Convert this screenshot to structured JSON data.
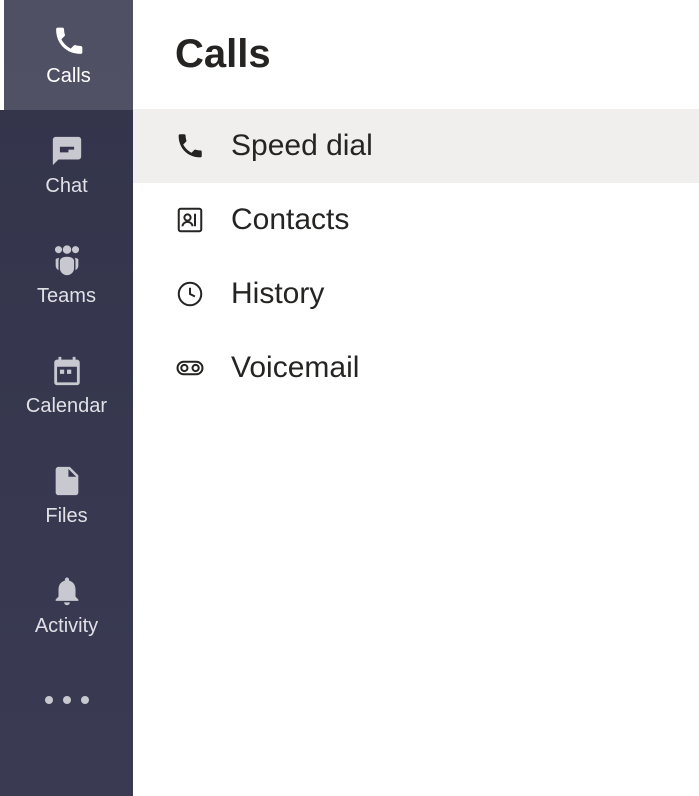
{
  "rail": {
    "items": [
      {
        "label": "Calls",
        "active": true
      },
      {
        "label": "Chat",
        "active": false
      },
      {
        "label": "Teams",
        "active": false
      },
      {
        "label": "Calendar",
        "active": false
      },
      {
        "label": "Files",
        "active": false
      },
      {
        "label": "Activity",
        "active": false
      }
    ]
  },
  "panel": {
    "title": "Calls",
    "items": [
      {
        "label": "Speed dial",
        "selected": true
      },
      {
        "label": "Contacts",
        "selected": false
      },
      {
        "label": "History",
        "selected": false
      },
      {
        "label": "Voicemail",
        "selected": false
      }
    ]
  }
}
